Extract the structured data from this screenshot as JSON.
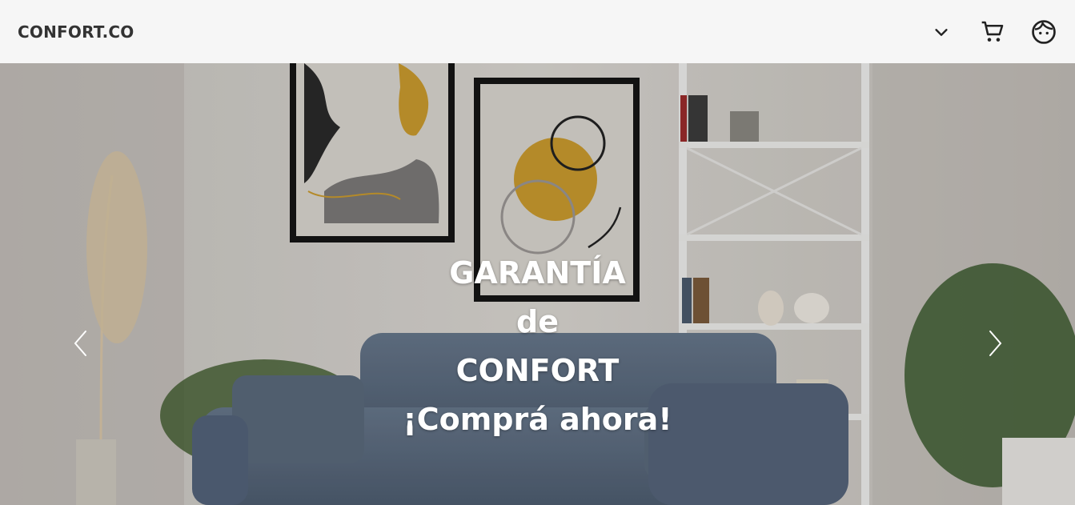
{
  "header": {
    "brand": "CONFORT.CO",
    "icons": [
      "chevron-down-icon",
      "cart-icon",
      "user-face-icon"
    ]
  },
  "hero": {
    "lines": [
      "GARANTÍA",
      "de",
      "CONFORT",
      "¡Comprá ahora!"
    ],
    "prev_icon": "chevron-left-icon",
    "next_icon": "chevron-right-icon"
  },
  "colors": {
    "header_bg": "#f6f6f6",
    "brand_text": "#333333",
    "sofa": "#5c6c7e",
    "art_mustard": "#c99a2e"
  }
}
